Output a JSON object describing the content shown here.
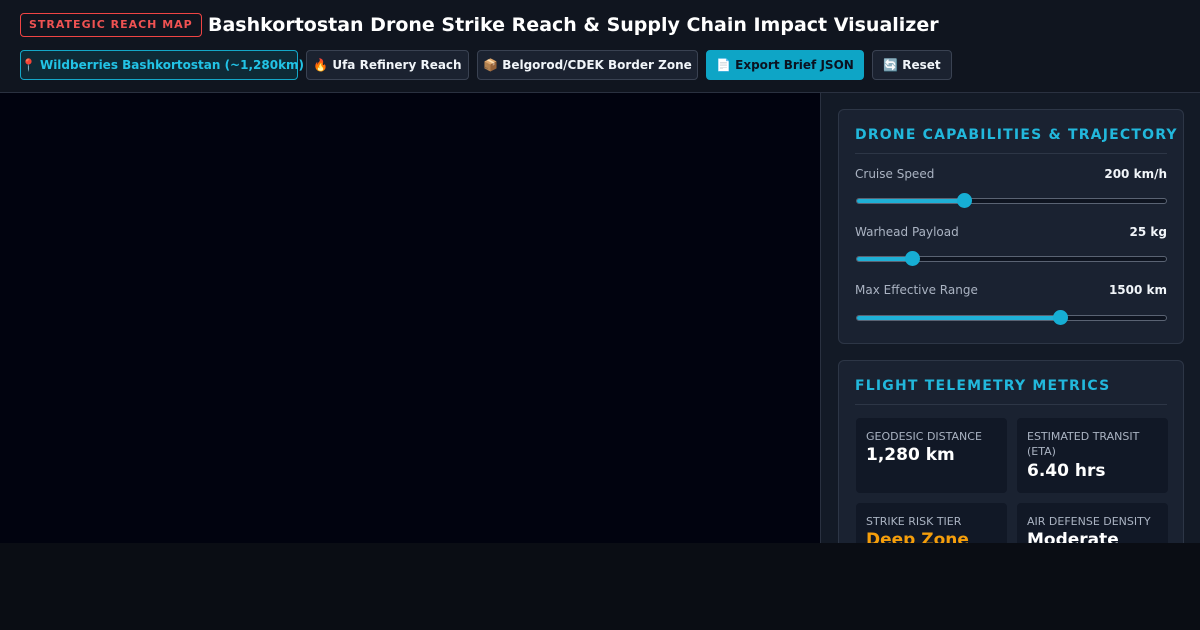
{
  "header": {
    "tag": "STRATEGIC REACH MAP",
    "title": "Bashkortostan Drone Strike Reach & Supply Chain Impact Visualizer",
    "buttons": {
      "wildberries": {
        "icon": "📍",
        "label": "Wildberries Bashkortostan (~1,280km)"
      },
      "ufa": {
        "icon": "🔥",
        "label": "Ufa Refinery Reach"
      },
      "belgorod": {
        "icon": "📦",
        "label": "Belgorod/CDEK Border Zone"
      },
      "export": {
        "icon": "📄",
        "label": "Export Brief JSON"
      },
      "reset": {
        "icon": "🔄",
        "label": "Reset"
      }
    }
  },
  "drone_panel": {
    "title": "DRONE CAPABILITIES & TRAJECTORY",
    "controls": [
      {
        "label": "Cruise Speed",
        "value": "200 km/h",
        "level": 0.35
      },
      {
        "label": "Warhead Payload",
        "value": "25 kg",
        "level": 0.18
      },
      {
        "label": "Max Effective Range",
        "value": "1500 km",
        "level": 0.66
      }
    ]
  },
  "telemetry": {
    "title": "FLIGHT TELEMETRY METRICS",
    "metrics": [
      {
        "label": "GEODESIC DISTANCE",
        "value": "1,280 km"
      },
      {
        "label": "ESTIMATED TRANSIT (ETA)",
        "value": "6.40 hrs"
      },
      {
        "label": "STRIKE RISK TIER",
        "value": "Deep Zone"
      },
      {
        "label": "AIR DEFENSE DENSITY",
        "value": "Moderate"
      }
    ]
  },
  "colors": {
    "accent": "#22b8dc",
    "danger": "#ef4444",
    "warning": "#f59e0b",
    "map_background": "#01030f"
  }
}
